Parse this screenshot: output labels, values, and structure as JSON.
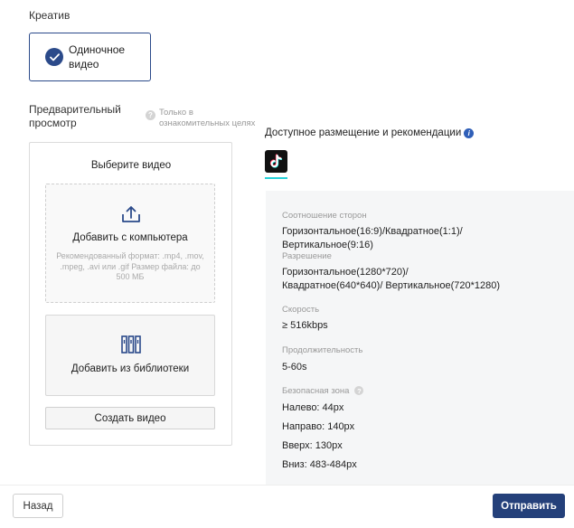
{
  "creative": {
    "label": "Креатив",
    "option_label": "Одиночное видео"
  },
  "preview": {
    "label": "Предварительный просмотр",
    "hint": "Только в ознакомительных целях"
  },
  "video_panel": {
    "title": "Выберите видео",
    "upload": {
      "title": "Добавить с компьютера",
      "hint": "Рекомендованный формат: .mp4, .mov, .mpeg, .avi или .gif Размер файла: до 500 МБ"
    },
    "library": {
      "title": "Добавить из библиотеки"
    },
    "create_button": "Создать видео"
  },
  "placement": {
    "title": "Доступное размещение и рекомендации",
    "platform_icon": "tiktok-icon",
    "specs": [
      {
        "label": "Соотношение сторон",
        "value": "Горизонтальное(16:9)/Квадратное(1:1)/Вертикальное(9:16)"
      },
      {
        "label": "Разрешение",
        "value": "Горизонтальное(1280*720)/Квадратное(640*640)/ Вертикальное(720*1280)"
      },
      {
        "label": "Скорость",
        "value": "≥ 516kbps"
      },
      {
        "label": "Продолжительность",
        "value": "5-60s"
      }
    ],
    "safe_zone": {
      "label": "Безопасная зона",
      "left": "Налево: 44px",
      "right": "Направо: 140px",
      "top": "Вверх: 130px",
      "bottom": "Вниз: 483-484px"
    }
  },
  "footer": {
    "back_label": "Назад",
    "submit_label": "Отправить"
  },
  "colors": {
    "primary": "#24407a",
    "accent": "#2b4a8a",
    "tiktok_underline": "#25d1d8"
  }
}
